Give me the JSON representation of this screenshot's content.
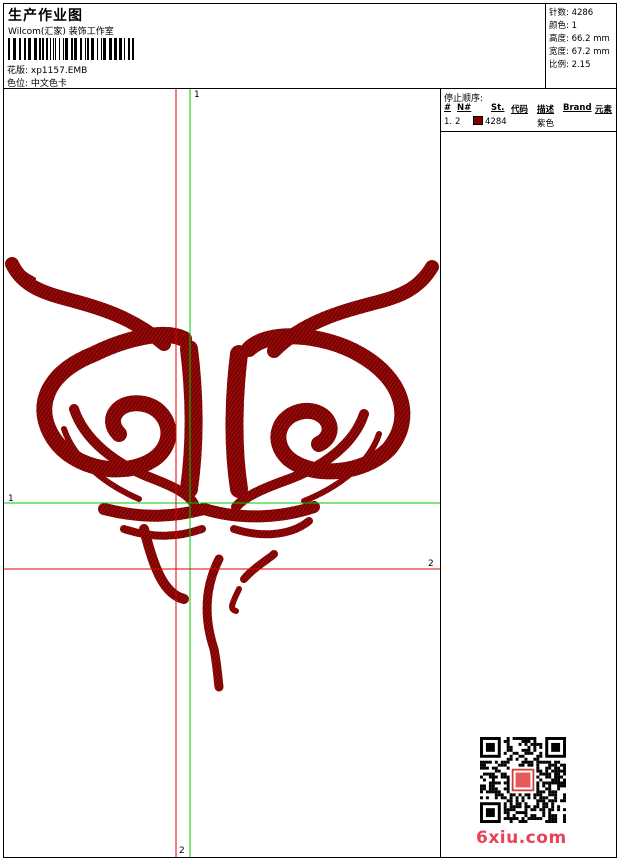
{
  "header": {
    "title": "生产作业图",
    "company": "Wilcom(汇家) 装饰工作室",
    "design_file": "花版: xp1157.EMB",
    "color_position": "色位: 中文色卡"
  },
  "stats": {
    "stitches": "针数: 4286",
    "colors": "颜色: 1",
    "height": "高度: 66.2 mm",
    "width": "宽度: 67.2 mm",
    "scale": "比例: 2.15"
  },
  "stop_sequence": {
    "title": "停止顺序:",
    "columns": [
      "#",
      "N#",
      "St.",
      "代码",
      "描述",
      "Brand",
      "元素"
    ],
    "rows": [
      {
        "index": "1.",
        "needle": "2",
        "stitches": "4284",
        "description": "紫色",
        "color": "#800000"
      }
    ]
  },
  "guides": {
    "green_v_label": "1",
    "green_h_label": "1",
    "red_h_label": "2",
    "red_v_label": "2"
  },
  "colors": {
    "thread": "#800000",
    "guide_green": "#00c800",
    "guide_red": "#e00000",
    "watermark": "#e8425a"
  },
  "watermark": "6xiu.com"
}
